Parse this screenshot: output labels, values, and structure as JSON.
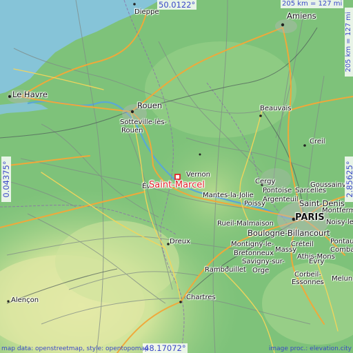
{
  "map": {
    "coords": {
      "top_lat": "50.0122°",
      "bottom_lat": "48.17072°",
      "left_lon": "0.04375°",
      "right_lon": "2.85625°",
      "scale_h": "205 km = 127 mi",
      "scale_v": "205 km = 127 mi"
    },
    "place": "Saint-Marcel",
    "cities": {
      "dieppe": "Dieppe",
      "amiens": "Amiens",
      "le_havre": "Le Havre",
      "rouen": "Rouen",
      "sotteville": "Sotteville-lès-",
      "sotteville2": "Rouen",
      "beauvais": "Beauvais",
      "creil": "Creil",
      "vernon": "Vernon",
      "cergy": "Cergy",
      "pontoise": "Pontoise",
      "sarcelles": "Sarcelles",
      "goussainville": "Goussainvil",
      "mantes": "Mantes-la-Jolie",
      "poissy": "Poissy",
      "argenteuil": "Argenteuil",
      "saint_denis": "Saint-Denis",
      "montfermeil": "Montfermeil",
      "rueil": "Rueil-Malmaison",
      "paris": "PARIS",
      "noisy": "Noisy-le-Gr",
      "dreux": "Dreux",
      "montigny": "Montigny-le-",
      "boulogne": "Boulogne-Billancourt",
      "bretonneux": "Bretonneux",
      "creteil": "Créteil",
      "pontault": "Pontault-",
      "combault": "Combault",
      "massy": "Massy",
      "athis": "Athis-Mons",
      "savigny": "Savigny-sur-",
      "orge": "Orge",
      "evry": "Évry",
      "rambouillet": "Rambouillet",
      "corbeil": "Corbeil-",
      "essonnes": "Essonnes",
      "melun": "Melun",
      "chartres": "Chartres",
      "alencon": "Alençon",
      "evreux_partial": "Év"
    },
    "credits": {
      "left": "map data: openstreetmap, style: opentopomap",
      "right": "image proc.: elevation.city"
    },
    "colors": {
      "sea": "#86c4d8",
      "lowland": "#7ec27a",
      "highland": "#e8e4a8",
      "label_blue": "#3a48c8",
      "highlight_red": "#e2232b"
    }
  }
}
